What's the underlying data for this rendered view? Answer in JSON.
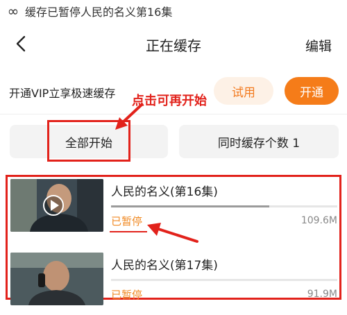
{
  "status_bar": {
    "text": "缓存已暂停人民的名义第16集"
  },
  "header": {
    "title": "正在缓存",
    "edit_label": "编辑"
  },
  "vip_bar": {
    "promo_text": "开通VIP立享极速缓存",
    "trial_label": "试用",
    "open_label": "开通"
  },
  "actions": {
    "start_all_label": "全部开始",
    "concurrent_label": "同时缓存个数 1"
  },
  "annotation": {
    "text": "点击可再开始"
  },
  "downloads": [
    {
      "title": "人民的名义(第16集)",
      "status": "已暂停",
      "size": "109.6M",
      "progress": 0.7
    },
    {
      "title": "人民的名义(第17集)",
      "status": "已暂停",
      "size": "91.9M",
      "progress": 0.0
    }
  ],
  "colors": {
    "accent": "#f57c19",
    "annotation": "#e2221b",
    "status": "#f08a24"
  }
}
